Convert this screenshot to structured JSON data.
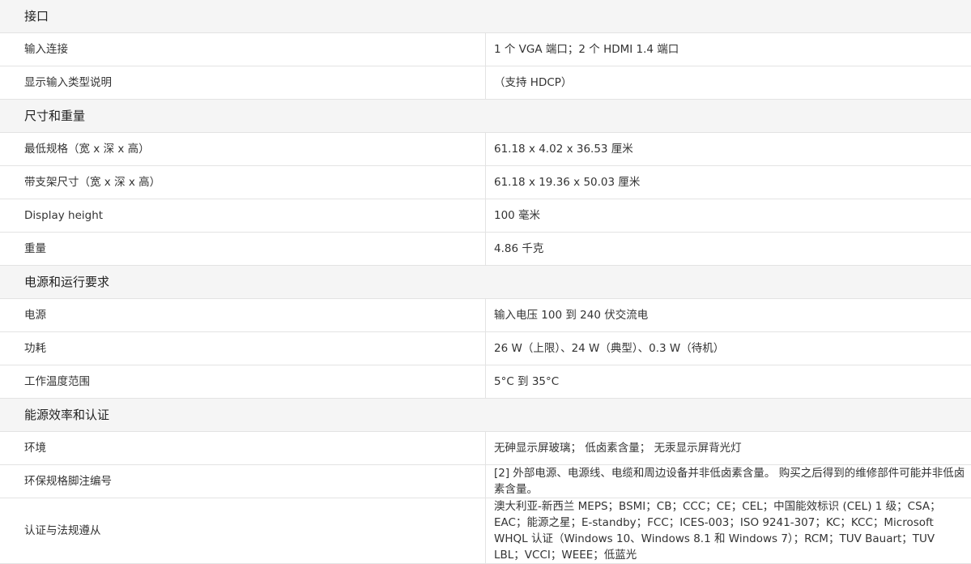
{
  "sections": [
    {
      "title": "接口",
      "rows": [
        {
          "label": "输入连接",
          "value": "1 个 VGA 端口；2 个 HDMI 1.4 端口"
        },
        {
          "label": "显示输入类型说明",
          "value": "（支持 HDCP）"
        }
      ]
    },
    {
      "title": "尺寸和重量",
      "rows": [
        {
          "label": "最低规格（宽 x 深 x 高）",
          "value": "61.18 x 4.02 x 36.53 厘米"
        },
        {
          "label": "带支架尺寸（宽 x 深 x 高）",
          "value": "61.18 x 19.36 x 50.03 厘米"
        },
        {
          "label": "Display height",
          "value": "100 毫米"
        },
        {
          "label": "重量",
          "value": "4.86 千克"
        }
      ]
    },
    {
      "title": "电源和运行要求",
      "rows": [
        {
          "label": "电源",
          "value": "输入电压 100 到 240 伏交流电"
        },
        {
          "label": "功耗",
          "value": "26 W（上限）、24 W（典型）、0.3 W（待机）"
        },
        {
          "label": "工作温度范围",
          "value": "5°C 到 35°C"
        }
      ]
    },
    {
      "title": "能源效率和认证",
      "rows": [
        {
          "label": "环境",
          "value": "无砷显示屏玻璃； 低卤素含量； 无汞显示屏背光灯"
        },
        {
          "label": "环保规格脚注编号",
          "value": "[2] 外部电源、电源线、电缆和周边设备并非低卤素含量。 购买之后得到的维修部件可能并非低卤素含量。"
        },
        {
          "label": "认证与法规遵从",
          "value": "澳大利亚-新西兰 MEPS；BSMI；CB；CCC；CE；CEL；中国能效标识 (CEL) 1 级；CSA；EAC；能源之星；E-standby；FCC；ICES-003；ISO 9241-307；KC；KCC；Microsoft WHQL 认证（Windows 10、Windows 8.1 和 Windows 7）；RCM；TUV Bauart；TUV LBL；VCCI；WEEE；低蓝光"
        }
      ]
    }
  ]
}
